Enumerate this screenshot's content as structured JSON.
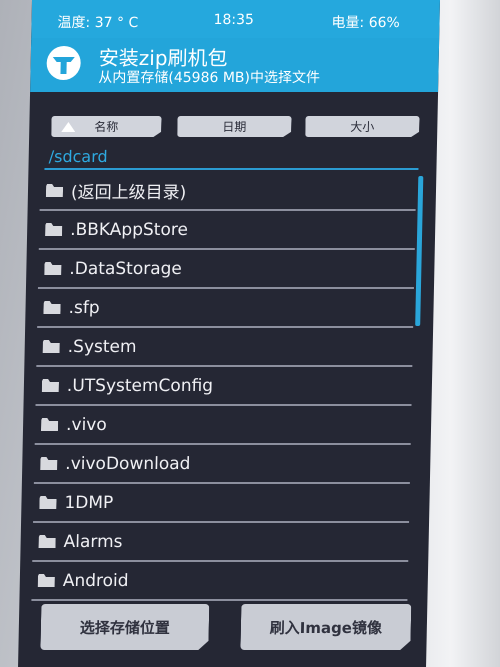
{
  "statusbar": {
    "temperature": "温度: 37 ° C",
    "time": "18:35",
    "battery": "电量: 66%"
  },
  "header": {
    "title": "安装zip刷机包",
    "subtitle": "从内置存储(45986 MB)中选择文件",
    "logo_icon": "twrp-logo-icon"
  },
  "sort": {
    "name": "名称",
    "date": "日期",
    "size": "大小",
    "active_icon": "sort-ascending-triangle-icon"
  },
  "path": "/sdcard",
  "files": [
    "(返回上级目录)",
    ".BBKAppStore",
    ".DataStorage",
    ".sfp",
    ".System",
    ".UTSystemConfig",
    ".vivo",
    ".vivoDownload",
    "1DMP",
    "Alarms",
    "Android"
  ],
  "bottom": {
    "select_storage": "选择存储位置",
    "flash_image": "刷入Image镜像"
  },
  "colors": {
    "accent": "#25a8dd",
    "background": "#252734",
    "button": "#c9ccd4"
  }
}
